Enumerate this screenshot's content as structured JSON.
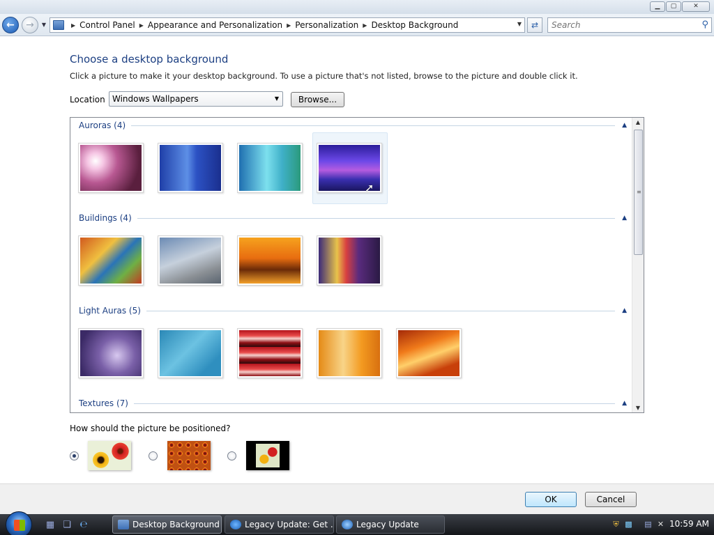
{
  "caption": {
    "buttons": [
      "▁",
      "▢",
      "✕"
    ]
  },
  "nav": {
    "breadcrumbs": [
      "Control Panel",
      "Appearance and Personalization",
      "Personalization",
      "Desktop Background"
    ],
    "search_placeholder": "Search"
  },
  "main": {
    "title": "Choose a desktop background",
    "description": "Click a picture to make it your desktop background. To use a picture that's not listed, browse to the picture and double click it.",
    "location_label": "Location",
    "location_value": "Windows Wallpapers",
    "browse_label": "Browse..."
  },
  "gallery": {
    "groups": [
      {
        "label": "Auroras (4)",
        "count": 4,
        "selected_index": 3
      },
      {
        "label": "Buildings (4)",
        "count": 4
      },
      {
        "label": "Light Auras (5)",
        "count": 5
      },
      {
        "label": "Textures (7)",
        "count": 7
      }
    ]
  },
  "position": {
    "question": "How should the picture be positioned?",
    "options": [
      "Fit to screen",
      "Tile",
      "Center"
    ],
    "selected": "Fit to screen"
  },
  "footer": {
    "ok_label": "OK",
    "cancel_label": "Cancel"
  },
  "taskbar": {
    "tasks": [
      "Desktop Background",
      "Legacy Update: Get ...",
      "Legacy Update"
    ],
    "active_task": "Desktop Background",
    "clock": "10:59 AM"
  },
  "icons": {
    "back": "back-arrow-icon",
    "forward": "forward-arrow-icon",
    "refresh": "refresh-icon",
    "search": "search-icon",
    "collapse": "chevron-up-icon"
  }
}
